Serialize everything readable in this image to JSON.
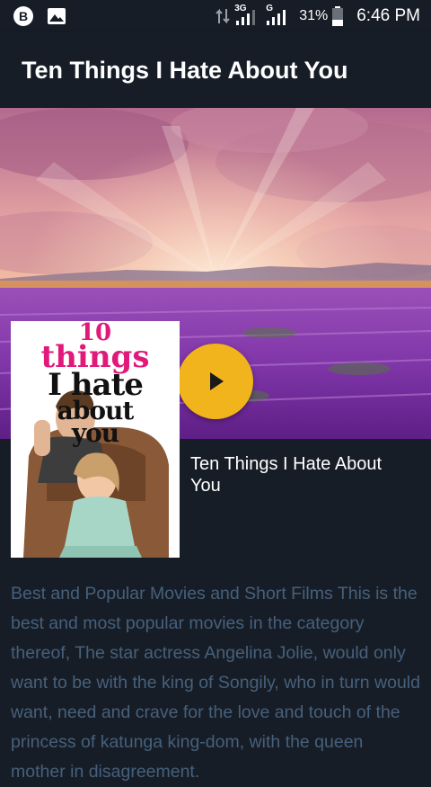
{
  "status_bar": {
    "network_3g": "3G",
    "network_g": "G",
    "battery_percent": "31%",
    "time": "6:46 PM",
    "icons": [
      "app-b-icon",
      "image-icon",
      "data-arrows-icon",
      "signal-icon",
      "signal-icon",
      "battery-icon"
    ]
  },
  "app_bar": {
    "title": "Ten Things I Hate About You"
  },
  "hero": {
    "play_icon": "play-icon",
    "accent_color": "#f2b41c"
  },
  "poster": {
    "line1": "10",
    "line2": "things",
    "line3": "I hate",
    "line4": "about",
    "line5": "you"
  },
  "movie": {
    "title": "Ten Things I Hate About You",
    "description": "Best and Popular Movies and Short Films This is the best and most popular movies in the category thereof, The star actress Angelina Jolie, would only want to be with the king of Songily, who in turn would want, need and crave for the love and touch of the princess of katunga king-dom, with the queen mother in disagreement."
  }
}
